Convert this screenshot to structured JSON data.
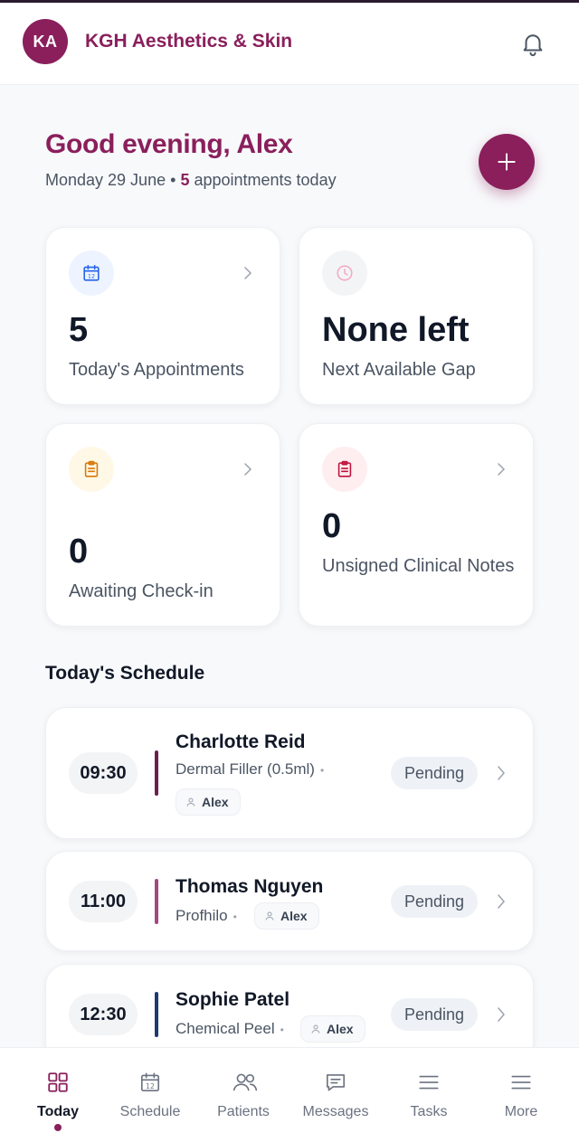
{
  "header": {
    "avatar_initials": "KA",
    "brand_name": "KGH Aesthetics & Skin"
  },
  "greeting": {
    "title": "Good evening, Alex",
    "date": "Monday 29 June",
    "separator": "•",
    "appointments_count": "5",
    "appointments_suffix": "appointments today"
  },
  "stats": [
    {
      "value": "5",
      "label": "Today's Appointments",
      "icon": "calendar-icon",
      "icon_color": "#2563eb",
      "icon_bg": "#eef4ff"
    },
    {
      "value": "None left",
      "label": "Next Available Gap",
      "icon": "clock-icon",
      "icon_color": "#f4a7bd",
      "icon_bg": "#f3f4f6"
    },
    {
      "value": "0",
      "label": "Awaiting Check-in",
      "icon": "clipboard-icon",
      "icon_color": "#d97706",
      "icon_bg": "#fff8e6"
    },
    {
      "value": "0",
      "label": "Unsigned Clinical Notes",
      "icon": "clipboard-icon",
      "icon_color": "#be123c",
      "icon_bg": "#ffeef0"
    }
  ],
  "schedule": {
    "title": "Today's Schedule",
    "appointments": [
      {
        "time": "09:30",
        "patient": "Charlotte Reid",
        "treatment": "Dermal Filler (0.5ml)",
        "staff": "Alex",
        "status": "Pending",
        "accent": "#6b1f4f"
      },
      {
        "time": "11:00",
        "patient": "Thomas Nguyen",
        "treatment": "Profhilo",
        "staff": "Alex",
        "status": "Pending",
        "accent": "#a34785"
      },
      {
        "time": "12:30",
        "patient": "Sophie Patel",
        "treatment": "Chemical Peel",
        "staff": "Alex",
        "status": "Pending",
        "accent": "#1e3a6e"
      }
    ]
  },
  "nav": {
    "items": [
      {
        "label": "Today",
        "icon": "grid-icon",
        "active": true
      },
      {
        "label": "Schedule",
        "icon": "calendar-icon"
      },
      {
        "label": "Patients",
        "icon": "users-icon"
      },
      {
        "label": "Messages",
        "icon": "message-icon"
      },
      {
        "label": "Tasks",
        "icon": "list-icon"
      },
      {
        "label": "More",
        "icon": "menu-icon"
      }
    ]
  },
  "colors": {
    "brand": "#8a1f5c",
    "text": "#111827",
    "muted": "#4b5563"
  }
}
